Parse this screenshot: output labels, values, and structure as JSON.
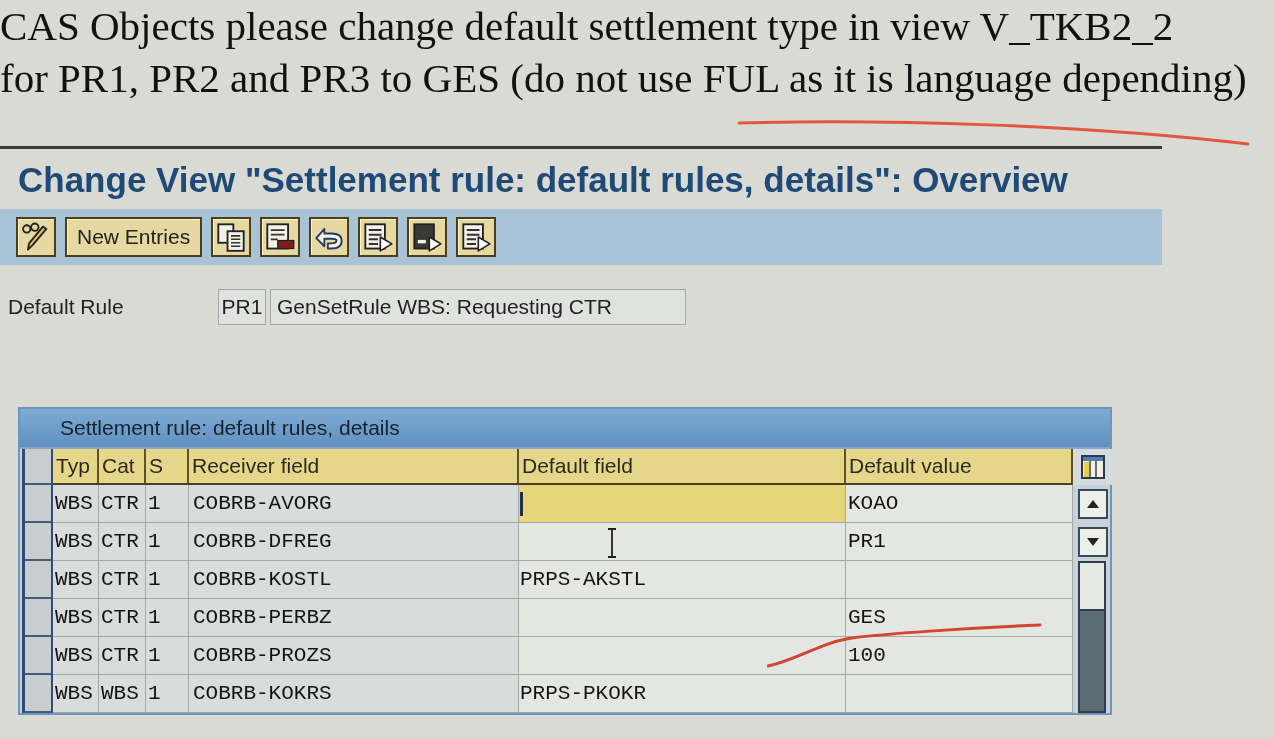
{
  "note": {
    "lines": [
      "CAS Objects please change default settlement type in view V_TKB2_2",
      "for PR1, PR2 and PR3 to GES (do not use FUL as it is language depending)"
    ]
  },
  "window": {
    "title": "Change View \"Settlement rule: default rules, details\": Overview"
  },
  "toolbar": {
    "buttons": [
      {
        "kind": "edit"
      },
      {
        "kind": "text",
        "label": "New Entries"
      },
      {
        "kind": "copy"
      },
      {
        "kind": "delete"
      },
      {
        "kind": "undo"
      },
      {
        "kind": "selectall"
      },
      {
        "kind": "selectblock"
      },
      {
        "kind": "deselectall"
      }
    ]
  },
  "default_rule": {
    "label": "Default Rule",
    "code": "PR1",
    "description": "GenSetRule WBS: Requesting CTR"
  },
  "table": {
    "title": "Settlement rule: default rules, details",
    "columns": [
      "Typ",
      "Cat",
      "S",
      "Receiver field",
      "Default field",
      "Default value"
    ],
    "rows": [
      {
        "selected": false,
        "typ": "WBS",
        "cat": "CTR",
        "s": "1",
        "receiver_field": "COBRB-AVORG",
        "default_field": {
          "focused": true,
          "hovered": false
        },
        "default_value": "KOAO"
      },
      {
        "selected": false,
        "typ": "WBS",
        "cat": "CTR",
        "s": "1",
        "receiver_field": "COBRB-DFREG",
        "default_field": {
          "focused": false,
          "hovered": true
        },
        "default_value": "PR1"
      },
      {
        "selected": false,
        "typ": "WBS",
        "cat": "CTR",
        "s": "1",
        "receiver_field": "COBRB-KOSTL",
        "default_field": {
          "value": "PRPS-AKSTL",
          "focused": false,
          "hovered": false
        }
      },
      {
        "selected": false,
        "typ": "WBS",
        "cat": "CTR",
        "s": "1",
        "receiver_field": "COBRB-PERBZ",
        "default_field": {
          "focused": false,
          "hovered": false
        },
        "default_value": "GES"
      },
      {
        "selected": false,
        "typ": "WBS",
        "cat": "CTR",
        "s": "1",
        "receiver_field": "COBRB-PROZS",
        "default_field": {
          "focused": false,
          "hovered": false
        },
        "default_value": "100"
      },
      {
        "selected": false,
        "typ": "WBS",
        "cat": "WBS",
        "s": "1",
        "receiver_field": "COBRB-KOKRS",
        "default_field": {
          "value": "PRPS-PKOKR",
          "focused": false,
          "hovered": false
        }
      }
    ]
  }
}
